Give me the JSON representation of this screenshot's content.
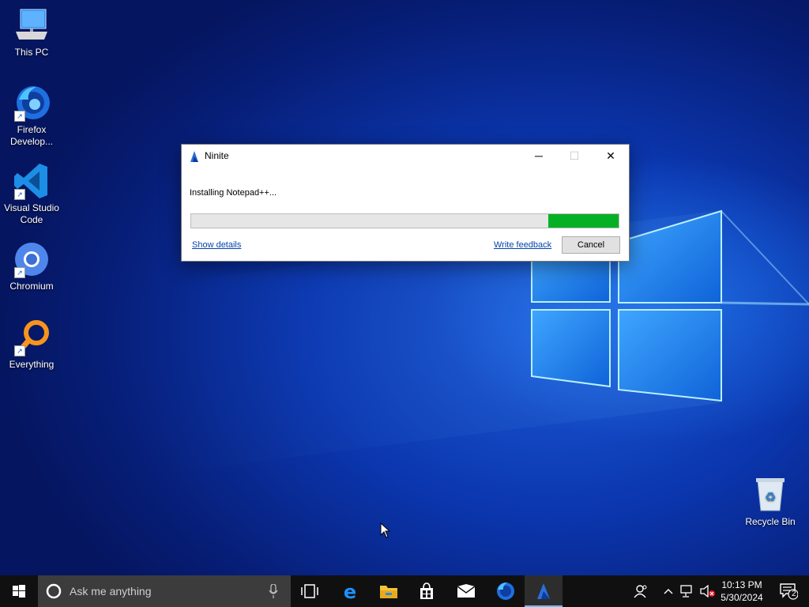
{
  "desktop": {
    "icons": [
      {
        "label": "This PC"
      },
      {
        "label": "Firefox\nDevelop..."
      },
      {
        "label": "Visual Studio\nCode"
      },
      {
        "label": "Chromium"
      },
      {
        "label": "Everything"
      },
      {
        "label": "Recycle Bin"
      }
    ]
  },
  "dialog": {
    "title": "Ninite",
    "status": "Installing Notepad++...",
    "progress_remaining_fraction_filled_green": 0.165,
    "show_details": "Show details",
    "write_feedback": "Write feedback",
    "cancel": "Cancel",
    "controls": {
      "minimize": "─",
      "maximize": "☐",
      "close": "✕"
    }
  },
  "taskbar": {
    "search_placeholder": "Ask me anything",
    "pinned": [
      "task-view",
      "edge",
      "file-explorer",
      "store",
      "mail",
      "firefox-developer",
      "ninite"
    ],
    "clock_time": "10:13 PM",
    "clock_date": "5/30/2024",
    "notification_count": "2"
  },
  "colors": {
    "progress_green": "#06b025",
    "taskbar_bg": "#101010",
    "link_blue": "#0645ad"
  }
}
